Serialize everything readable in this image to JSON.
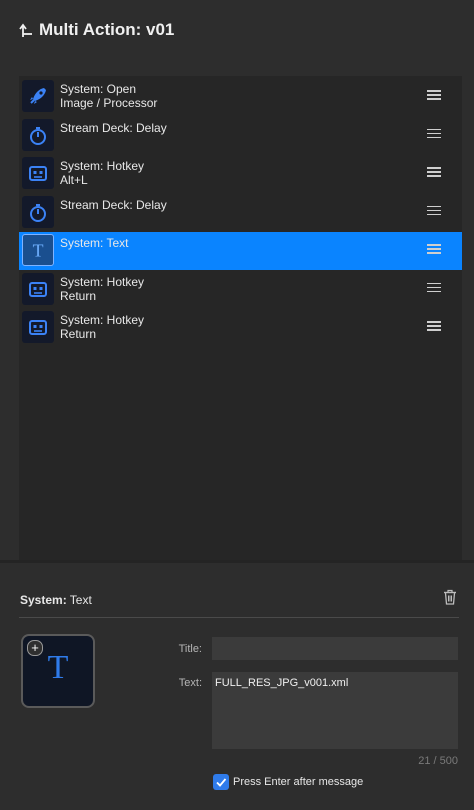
{
  "header": {
    "title": "Multi Action: v01",
    "back_icon": "return-arrow-icon"
  },
  "actions": [
    {
      "label": "System: Open\nImage / Processor",
      "icon": "rocket-icon",
      "selected": false
    },
    {
      "label": "Stream Deck: Delay",
      "icon": "stopwatch-icon",
      "selected": false
    },
    {
      "label": "System: Hotkey\nAlt+L",
      "icon": "hotkey-robot-icon",
      "selected": false
    },
    {
      "label": "Stream Deck: Delay",
      "icon": "stopwatch-icon",
      "selected": false
    },
    {
      "label": "System: Text",
      "icon": "text-t-icon",
      "selected": true
    },
    {
      "label": "System: Hotkey\nReturn",
      "icon": "hotkey-robot-icon",
      "selected": false
    },
    {
      "label": "System: Hotkey\nReturn",
      "icon": "hotkey-robot-icon",
      "selected": false
    }
  ],
  "details": {
    "title_bold": "System:",
    "title_rest": " Text",
    "key_glyph": "T",
    "add_badge": "+",
    "title_label": "Title:",
    "title_value": "",
    "text_label": "Text:",
    "text_value": "FULL_RES_JPG_v001.xml",
    "char_count": "21 / 500",
    "checkbox_checked": true,
    "checkbox_label": "Press Enter after message"
  },
  "colors": {
    "accent": "#0a84ff",
    "icon_blue": "#2f7bea",
    "background": "#2d2d2d",
    "list_background": "#262626"
  }
}
